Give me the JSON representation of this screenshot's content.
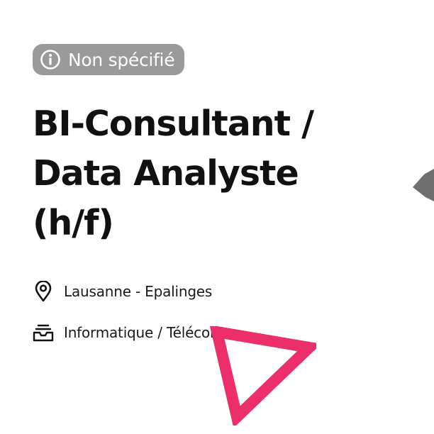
{
  "badge": {
    "icon": "info-circle-icon",
    "label": "Non spécifié",
    "background": "#9a9a9a",
    "text_color": "#ffffff"
  },
  "job": {
    "title_lines": [
      "BI-Consultant /",
      "Data Analyste",
      "(h/f)"
    ],
    "location": {
      "icon": "location-pin-icon",
      "text": "Lausanne - Epalinges"
    },
    "category": {
      "icon": "inbox-tray-icon",
      "text": "Informatique / Télécomm."
    }
  },
  "decorations": {
    "triangle_color": "#ec2f6b",
    "edge_shape_color": "#6e6e6e"
  }
}
